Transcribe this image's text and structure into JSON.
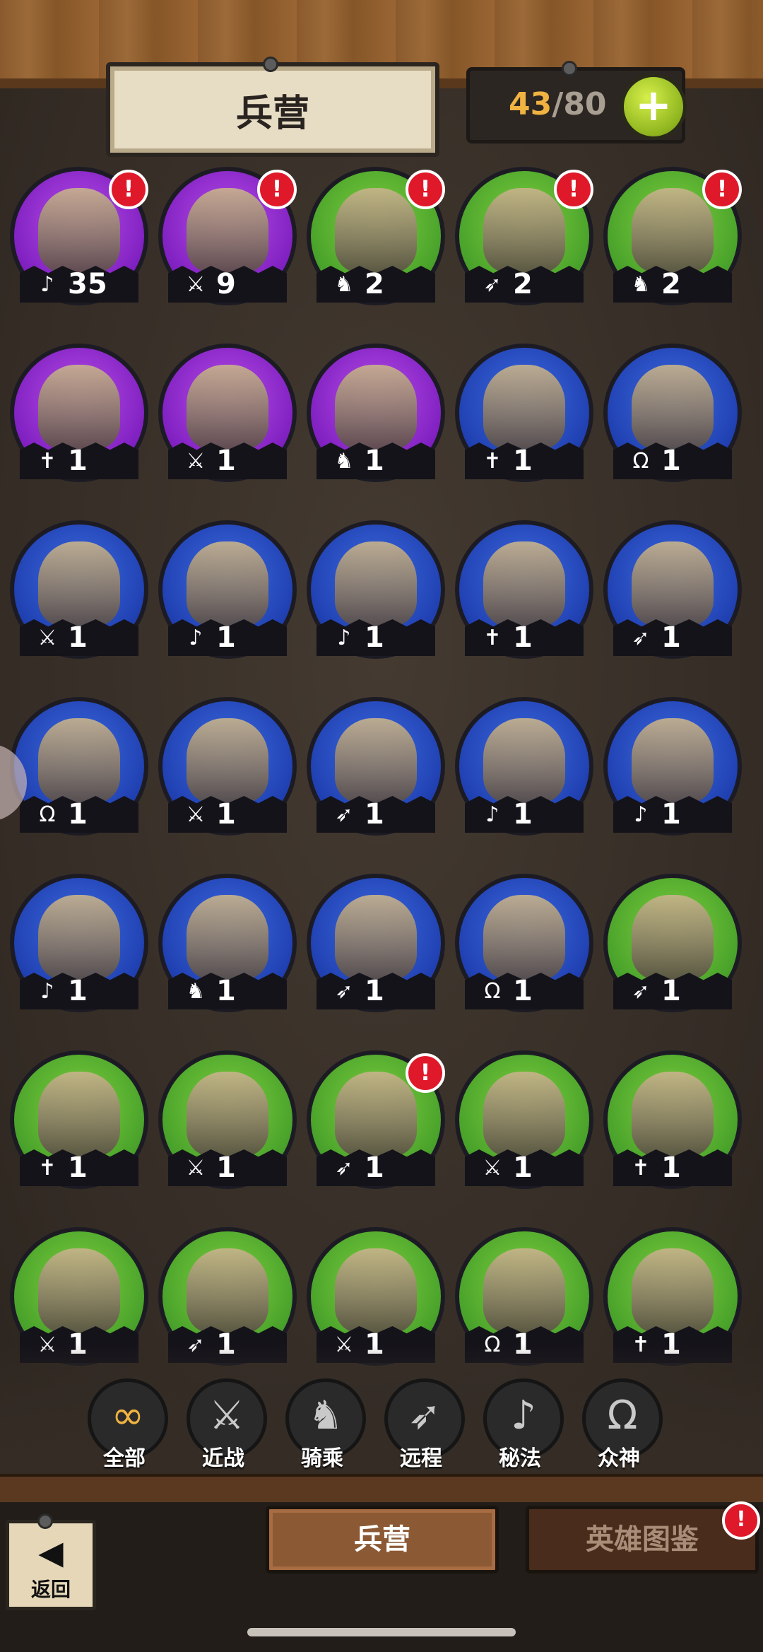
{
  "header": {
    "title": "兵营",
    "count_current": "43",
    "count_separator": "/",
    "count_max": "80",
    "plus_label": "+"
  },
  "units": [
    {
      "color": "purple",
      "class": "arcane",
      "class_glyph": "♪",
      "count": "35",
      "alert": true
    },
    {
      "color": "purple",
      "class": "melee",
      "class_glyph": "⚔",
      "count": "9",
      "alert": true
    },
    {
      "color": "green",
      "class": "mounted",
      "class_glyph": "♞",
      "count": "2",
      "alert": true
    },
    {
      "color": "green",
      "class": "ranged",
      "class_glyph": "➶",
      "count": "2",
      "alert": true
    },
    {
      "color": "green",
      "class": "mounted",
      "class_glyph": "♞",
      "count": "2",
      "alert": true
    },
    {
      "color": "purple",
      "class": "divine",
      "class_glyph": "✝",
      "count": "1",
      "alert": false
    },
    {
      "color": "purple",
      "class": "melee",
      "class_glyph": "⚔",
      "count": "1",
      "alert": false
    },
    {
      "color": "purple",
      "class": "mounted",
      "class_glyph": "♞",
      "count": "1",
      "alert": false
    },
    {
      "color": "blue",
      "class": "divine",
      "class_glyph": "✝",
      "count": "1",
      "alert": false
    },
    {
      "color": "blue",
      "class": "pantheon",
      "class_glyph": "Ω",
      "count": "1",
      "alert": false
    },
    {
      "color": "blue",
      "class": "melee",
      "class_glyph": "⚔",
      "count": "1",
      "alert": false
    },
    {
      "color": "blue",
      "class": "arcane",
      "class_glyph": "♪",
      "count": "1",
      "alert": false
    },
    {
      "color": "blue",
      "class": "arcane",
      "class_glyph": "♪",
      "count": "1",
      "alert": false
    },
    {
      "color": "blue",
      "class": "divine",
      "class_glyph": "✝",
      "count": "1",
      "alert": false
    },
    {
      "color": "blue",
      "class": "ranged",
      "class_glyph": "➶",
      "count": "1",
      "alert": false
    },
    {
      "color": "blue",
      "class": "pantheon",
      "class_glyph": "Ω",
      "count": "1",
      "alert": false
    },
    {
      "color": "blue",
      "class": "melee",
      "class_glyph": "⚔",
      "count": "1",
      "alert": false
    },
    {
      "color": "blue",
      "class": "ranged",
      "class_glyph": "➶",
      "count": "1",
      "alert": false
    },
    {
      "color": "blue",
      "class": "arcane",
      "class_glyph": "♪",
      "count": "1",
      "alert": false
    },
    {
      "color": "blue",
      "class": "arcane",
      "class_glyph": "♪",
      "count": "1",
      "alert": false
    },
    {
      "color": "blue",
      "class": "arcane",
      "class_glyph": "♪",
      "count": "1",
      "alert": false
    },
    {
      "color": "blue",
      "class": "mounted",
      "class_glyph": "♞",
      "count": "1",
      "alert": false
    },
    {
      "color": "blue",
      "class": "ranged",
      "class_glyph": "➶",
      "count": "1",
      "alert": false
    },
    {
      "color": "blue",
      "class": "pantheon",
      "class_glyph": "Ω",
      "count": "1",
      "alert": false
    },
    {
      "color": "green",
      "class": "ranged",
      "class_glyph": "➶",
      "count": "1",
      "alert": false
    },
    {
      "color": "green",
      "class": "divine",
      "class_glyph": "✝",
      "count": "1",
      "alert": false
    },
    {
      "color": "green",
      "class": "melee",
      "class_glyph": "⚔",
      "count": "1",
      "alert": false
    },
    {
      "color": "green",
      "class": "ranged",
      "class_glyph": "➶",
      "count": "1",
      "alert": true
    },
    {
      "color": "green",
      "class": "melee",
      "class_glyph": "⚔",
      "count": "1",
      "alert": false
    },
    {
      "color": "green",
      "class": "divine",
      "class_glyph": "✝",
      "count": "1",
      "alert": false
    },
    {
      "color": "green",
      "class": "melee",
      "class_glyph": "⚔",
      "count": "1",
      "alert": false
    },
    {
      "color": "green",
      "class": "ranged",
      "class_glyph": "➶",
      "count": "1",
      "alert": false
    },
    {
      "color": "green",
      "class": "melee",
      "class_glyph": "⚔",
      "count": "1",
      "alert": false
    },
    {
      "color": "green",
      "class": "pantheon",
      "class_glyph": "Ω",
      "count": "1",
      "alert": false
    },
    {
      "color": "green",
      "class": "divine",
      "class_glyph": "✝",
      "count": "1",
      "alert": false
    }
  ],
  "alert_glyph": "!",
  "filters": [
    {
      "label": "全部",
      "icon": "infinity-icon",
      "glyph": "∞",
      "active": true
    },
    {
      "label": "近战",
      "icon": "sword-icon",
      "glyph": "⚔",
      "active": false
    },
    {
      "label": "骑乘",
      "icon": "horse-icon",
      "glyph": "♞",
      "active": false
    },
    {
      "label": "远程",
      "icon": "bow-icon",
      "glyph": "➶",
      "active": false
    },
    {
      "label": "秘法",
      "icon": "arcane-icon",
      "glyph": "♪",
      "active": false
    },
    {
      "label": "众神",
      "icon": "omega-icon",
      "glyph": "Ω",
      "active": false
    }
  ],
  "tabs": {
    "barracks": "兵营",
    "codex": "英雄图鉴",
    "codex_alert": "!"
  },
  "back": {
    "arrow": "◀",
    "label": "返回"
  },
  "colors": {
    "purple": "#8a2bd0",
    "blue": "#1f3fb0",
    "green": "#47a02a",
    "accent": "#f0b341",
    "alert": "#e0192a"
  }
}
